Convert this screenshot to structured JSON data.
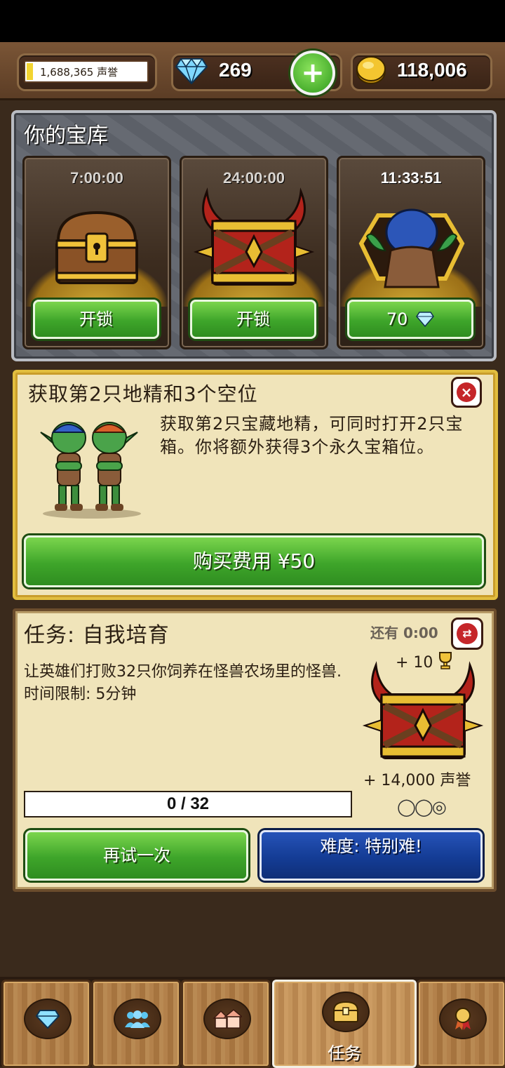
{
  "top_bar": {
    "reputation": "1,688,365 声誉",
    "gems": "269",
    "add_label": "+",
    "gold": "118,006"
  },
  "vault": {
    "title": "你的宝库",
    "chests": [
      {
        "timer": "7:00:00",
        "button": "开锁",
        "kind": "wooden-chest"
      },
      {
        "timer": "24:00:00",
        "button": "开锁",
        "kind": "horned-red-chest"
      },
      {
        "timer": "11:33:51",
        "button": "70",
        "button_icon": "gem",
        "kind": "goblin-chest"
      }
    ]
  },
  "offer": {
    "title": "获取第2只地精和3个空位",
    "close": "×",
    "description": "获取第2只宝藏地精，可同时打开2只宝箱。你将额外获得3个永久宝箱位。",
    "buy_button": "购买费用 ¥50"
  },
  "quest": {
    "title": "任务: 自我培育",
    "time_remaining": "还有 0:00",
    "swap": "⇄",
    "description": "让英雄们打败32只你饲养在怪兽农场里的怪兽. 时间限制: 5分钟",
    "trophy_reward": "+ 10",
    "reputation_reward": "+ 14,000 声誉",
    "difficulty_rings": "◯◯◎",
    "progress_text": "0 / 32",
    "progress_fraction": 0,
    "retry_button": "再试一次",
    "difficulty_button": "难度: 特别难!"
  },
  "nav": {
    "tabs": [
      {
        "icon": "gem-icon",
        "label": ""
      },
      {
        "icon": "people-icon",
        "label": ""
      },
      {
        "icon": "house-icon",
        "label": ""
      },
      {
        "icon": "chest-icon",
        "label": "任务",
        "active": true
      },
      {
        "icon": "medal-icon",
        "label": ""
      }
    ]
  },
  "colors": {
    "green_button": "#3ea52a",
    "blue_button": "#143c95",
    "panel_bg": "#f0e4ba",
    "offer_border": "#e2be3f"
  }
}
